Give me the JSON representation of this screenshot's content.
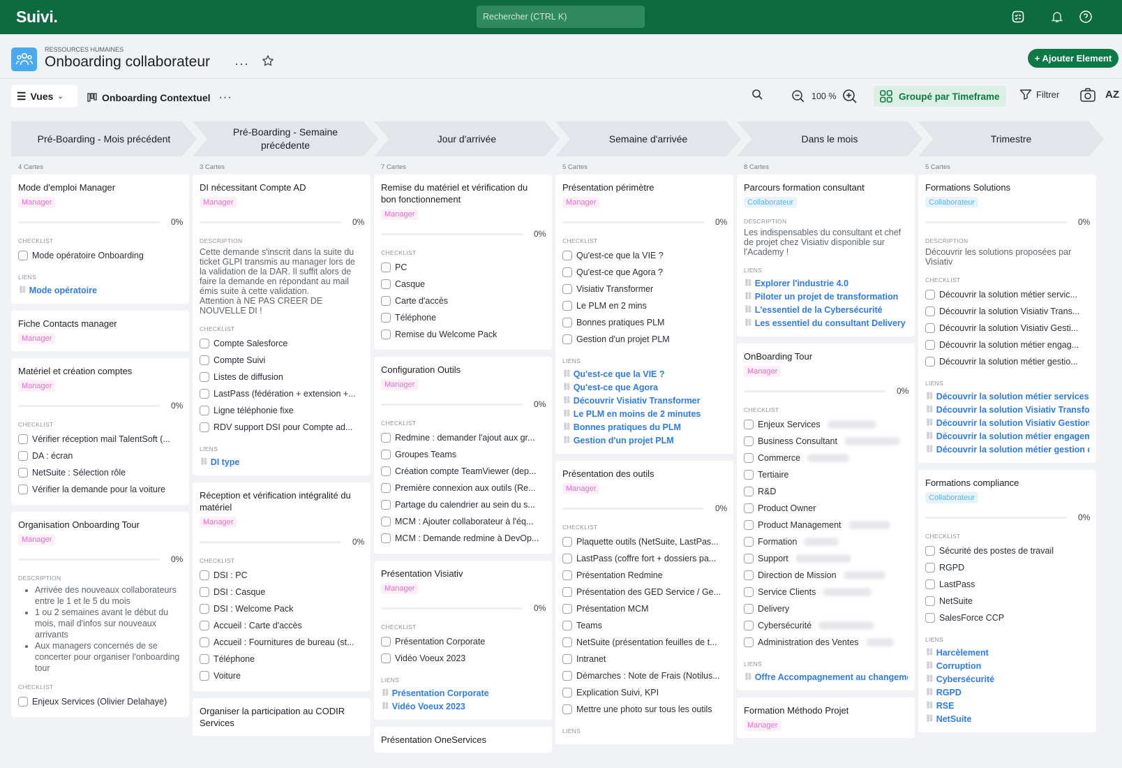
{
  "app": {
    "logo": "Suivi.",
    "search_placeholder": "Rechercher (CTRL K)"
  },
  "header": {
    "breadcrumb": "RESSOURCES HUMAINES",
    "title": "Onboarding collaborateur",
    "more": "···",
    "add_button": "+ Ajouter Element"
  },
  "toolbar": {
    "views": "Vues",
    "view_name": "Onboarding Contextuel",
    "more": "···",
    "zoom": "100 %",
    "group": "Groupé par Timeframe",
    "filter": "Filtrer",
    "sort": "AZ"
  },
  "columns": [
    {
      "title": "Pré-Boarding - Mois précédent",
      "count": "4 Cartes",
      "cards": [
        {
          "title": "Mode d'emploi Manager",
          "tag": "Manager",
          "tag_type": "m",
          "progress": "0%",
          "checklist_label": "CHECKLIST",
          "checklist": [
            "Mode opératoire Onboarding"
          ],
          "links_label": "LIENS",
          "links": [
            "Mode opératoire"
          ]
        },
        {
          "title": "Fiche Contacts manager",
          "tag": "Manager",
          "tag_type": "m"
        },
        {
          "title": "Matériel et création comptes",
          "tag": "Manager",
          "tag_type": "m",
          "progress": "0%",
          "checklist_label": "CHECKLIST",
          "checklist": [
            "Vérifier réception mail TalentSoft (...",
            "DA : écran",
            "NetSuite : Sélection rôle",
            "Vérifier la demande pour la voiture"
          ]
        },
        {
          "title": "Organisation Onboarding Tour",
          "tag": "Manager",
          "tag_type": "m",
          "progress": "0%",
          "desc_label": "DESCRIPTION",
          "bullets": [
            "Arrivée des nouveaux collaborateurs entre le 1 et le 5 du mois",
            "1 ou 2 semaines avant le début du mois, mail d'infos sur nouveaux arrivants",
            "Aux managers concernés de se concerter pour organiser l'onboarding tour"
          ],
          "checklist_label": "CHECKLIST",
          "checklist": [
            "Enjeux Services (Olivier Delahaye)"
          ]
        }
      ]
    },
    {
      "title": "Pré-Boarding - Semaine précédente",
      "count": "3 Cartes",
      "cards": [
        {
          "title": "DI nécessitant Compte AD",
          "tag": "Manager",
          "tag_type": "m",
          "progress": "0%",
          "desc_label": "DESCRIPTION",
          "desc": "Cette demande s'inscrit dans la suite du ticket GLPI transmis au manager lors de la validation de la DAR. Il suffit alors de faire la demande en répondant au mail émis suite à cette validation.\nAttention à NE PAS CREER DE NOUVELLE DI !",
          "checklist_label": "CHECKLIST",
          "checklist": [
            "Compte Salesforce",
            "Compte Suivi",
            "Listes de diffusion",
            "LastPass (fédération + extension +...",
            "Ligne téléphonie fixe",
            "RDV support DSI pour Compte ad..."
          ],
          "links_label": "LIENS",
          "links": [
            "DI type"
          ]
        },
        {
          "title": "Réception et vérification intégralité du matériel",
          "tag": "Manager",
          "tag_type": "m",
          "progress": "0%",
          "checklist_label": "CHECKLIST",
          "checklist": [
            "DSI : PC",
            "DSI : Casque",
            "DSI : Welcome Pack",
            "Accueil : Carte d'accès",
            "Accueil : Fournitures de bureau (st...",
            "Téléphone",
            "Voiture"
          ]
        },
        {
          "title": "Organiser la participation au CODIR Services"
        }
      ]
    },
    {
      "title": "Jour d'arrivée",
      "count": "7 Cartes",
      "cards": [
        {
          "title": "Remise du matériel et vérification du bon fonctionnement",
          "tag": "Manager",
          "tag_type": "m",
          "progress": "0%",
          "checklist_label": "CHECKLIST",
          "checklist": [
            "PC",
            "Casque",
            "Carte d'accès",
            "Téléphone",
            "Remise du Welcome Pack"
          ]
        },
        {
          "title": "Configuration Outils",
          "tag": "Manager",
          "tag_type": "m",
          "progress": "0%",
          "checklist_label": "CHECKLIST",
          "checklist": [
            "Redmine : demander l'ajout aux gr...",
            "Groupes Teams",
            "Création compte TeamViewer (dep...",
            "Première connexion aux outils (Re...",
            "Partage du calendrier au sein du s...",
            "MCM : Ajouter collaborateur à l'éq...",
            "MCM : Demande redmine à DevOp..."
          ]
        },
        {
          "title": "Présentation Visiativ",
          "tag": "Manager",
          "tag_type": "m",
          "progress": "0%",
          "checklist_label": "CHECKLIST",
          "checklist": [
            "Présentation Corporate",
            "Vidéo Voeux 2023"
          ],
          "links_label": "LIENS",
          "links": [
            "Présentation Corporate",
            "Vidéo Voeux 2023"
          ]
        },
        {
          "title": "Présentation OneServices"
        }
      ]
    },
    {
      "title": "Semaine d'arrivée",
      "count": "5 Cartes",
      "cards": [
        {
          "title": "Présentation périmètre",
          "tag": "Manager",
          "tag_type": "m",
          "progress": "0%",
          "checklist_label": "CHECKLIST",
          "checklist": [
            "Qu'est-ce que la VIE ?",
            "Qu'est-ce que Agora ?",
            "Visiativ Transformer",
            "Le PLM en 2 mins",
            "Bonnes pratiques PLM",
            "Gestion d'un projet PLM"
          ],
          "links_label": "LIENS",
          "links": [
            "Qu'est-ce que la VIE ?",
            "Qu'est-ce que Agora",
            "Découvrir Visiativ Transformer",
            "Le PLM en moins de 2 minutes",
            "Bonnes pratiques du PLM",
            "Gestion d'un projet PLM"
          ]
        },
        {
          "title": "Présentation des outils",
          "tag": "Manager",
          "tag_type": "m",
          "progress": "0%",
          "checklist_label": "CHECKLIST",
          "checklist": [
            "Plaquette outils (NetSuite, LastPas...",
            "LastPass (coffre fort + dossiers pa...",
            "Présentation Redmine",
            "Présentation des GED Service / Ge...",
            "Présentation MCM",
            "Teams",
            "NetSuite (présentation feuilles de t...",
            "Intranet",
            "Démarches : Note de Frais (Notilus...",
            "Explication Suivi, KPI",
            "Mettre une photo sur tous les outils"
          ],
          "links_label": "LIENS"
        }
      ]
    },
    {
      "title": "Dans le mois",
      "count": "8 Cartes",
      "cards": [
        {
          "title": "Parcours formation consultant",
          "tag": "Collaborateur",
          "tag_type": "c",
          "desc_label": "DESCRIPTION",
          "desc": "Les indispensables du consultant et chef de projet chez Visiativ disponible sur l'Academy !",
          "links_label": "LIENS",
          "links": [
            "Explorer l'industrie 4.0",
            "Piloter un projet de transformation",
            "L'essentiel de la Cybersécurité",
            "Les essentiel du consultant Delivery"
          ]
        },
        {
          "title": "OnBoarding Tour",
          "tag": "Manager",
          "tag_type": "m",
          "progress": "0%",
          "checklist_label": "CHECKLIST",
          "checklist": [
            "Enjeux Services",
            "Business Consultant",
            "Commerce",
            "Tertiaire",
            "R&D",
            "Product Owner",
            "Product Management",
            "Formation",
            "Support",
            "Direction de Mission",
            "Service Clients",
            "Delivery",
            "Cybersécurité",
            "Administration des Ventes"
          ],
          "links_label": "LIENS",
          "links": [
            "Offre Accompagnement au changement"
          ]
        },
        {
          "title": "Formation Méthodo Projet",
          "tag": "Manager",
          "tag_type": "m"
        }
      ]
    },
    {
      "title": "Trimestre",
      "count": "5 Cartes",
      "cards": [
        {
          "title": "Formations Solutions",
          "tag": "Collaborateur",
          "tag_type": "c",
          "progress": "0%",
          "desc_label": "DESCRIPTION",
          "desc": "Découvrir les solutions proposées par Visiativ",
          "checklist_label": "CHECKLIST",
          "checklist": [
            "Découvrir la solution métier servic...",
            "Découvrir la solution Visiativ Trans...",
            "Découvrir la solution Visiativ Gesti...",
            "Découvrir la solution métier engag...",
            "Découvrir la solution métier gestio..."
          ],
          "links_label": "LIENS",
          "links": [
            "Découvrir la solution métier services clients",
            "Découvrir la solution Visiativ Transformer",
            "Découvrir la solution Visiativ Gestion de",
            "Découvrir la solution métier engagement",
            "Découvrir la solution métier gestion du"
          ]
        },
        {
          "title": "Formations compliance",
          "tag": "Collaborateur",
          "tag_type": "c",
          "progress": "0%",
          "checklist_label": "CHECKLIST",
          "checklist": [
            "Sécurité des postes de travail",
            "RGPD",
            "LastPass",
            "NetSuite",
            "SalesForce CCP"
          ],
          "links_label": "LIENS",
          "links": [
            "Harcèlement",
            "Corruption",
            "Cybersécurité",
            "RGPD",
            "RSE",
            "NetSuite"
          ]
        }
      ]
    }
  ]
}
